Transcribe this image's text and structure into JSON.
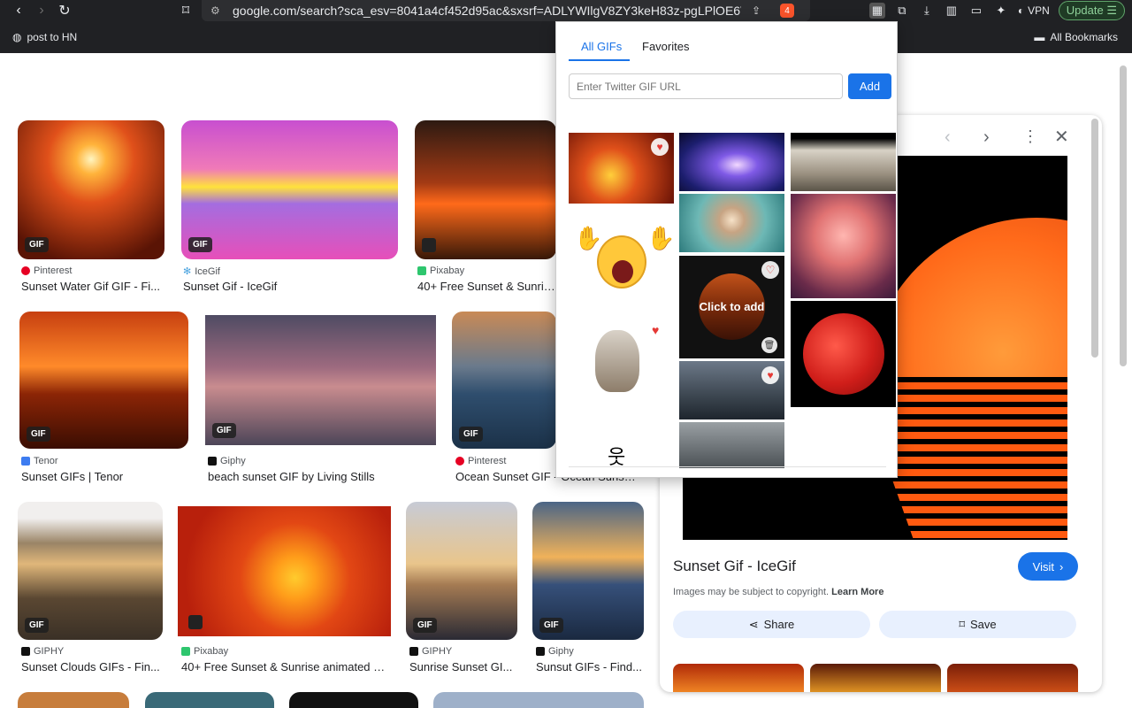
{
  "browser": {
    "url": "google.com/search?sca_esv=8041a4cf452d95ac&sxsrf=ADLYWIlgV8ZY3keH83z-pgLPlOE6V-V3j...",
    "bookmark_left": "post to HN",
    "bookmark_right": "All Bookmarks",
    "vpn_label": "VPN",
    "update_label": "Update",
    "brave_badge": "4"
  },
  "results": [
    {
      "source": "Pinterest",
      "caption": "Sunset Water Gif GIF - Fi...",
      "badge": "GIF",
      "source_color": "#e60023"
    },
    {
      "source": "IceGif",
      "caption": "Sunset Gif - IceGif",
      "badge": "GIF",
      "source_color": "#4aa3df"
    },
    {
      "source": "Pixabay",
      "caption": "40+ Free Sunset & Sunrise a",
      "badge": "",
      "source_color": "#2ec66e"
    },
    {
      "source": "Tenor",
      "caption": "Sunset GIFs | Tenor",
      "badge": "GIF",
      "source_color": "#3d7cf0"
    },
    {
      "source": "Giphy",
      "caption": "beach sunset GIF by Living Stills",
      "badge": "GIF",
      "source_color": "#111111"
    },
    {
      "source": "Pinterest",
      "caption": "Ocean Sunset GIF - Ocean Sunset ...",
      "badge": "GIF",
      "source_color": "#e60023"
    },
    {
      "source": "GIPHY",
      "caption": "Sunset Clouds GIFs - Fin...",
      "badge": "GIF",
      "source_color": "#111111"
    },
    {
      "source": "Pixabay",
      "caption": "40+ Free Sunset & Sunrise animated G...",
      "badge": "",
      "source_color": "#2ec66e"
    },
    {
      "source": "GIPHY",
      "caption": "Sunrise Sunset GI...",
      "badge": "GIF",
      "source_color": "#111111"
    },
    {
      "source": "Giphy",
      "caption": "Sunsut GIFs - Find...",
      "badge": "GIF",
      "source_color": "#111111"
    }
  ],
  "side_panel": {
    "title": "Sunset Gif - IceGif",
    "visit_label": "Visit",
    "copyright": "Images may be subject to copyright.",
    "learn_more": "Learn More",
    "share_label": "Share",
    "save_label": "Save"
  },
  "popup": {
    "tab_all": "All GIFs",
    "tab_favorites": "Favorites",
    "url_placeholder": "Enter Twitter GIF URL",
    "add_label": "Add",
    "hover_label": "Click to add"
  },
  "colors": {
    "accent": "#1a73e8",
    "heart": "#e53935"
  }
}
